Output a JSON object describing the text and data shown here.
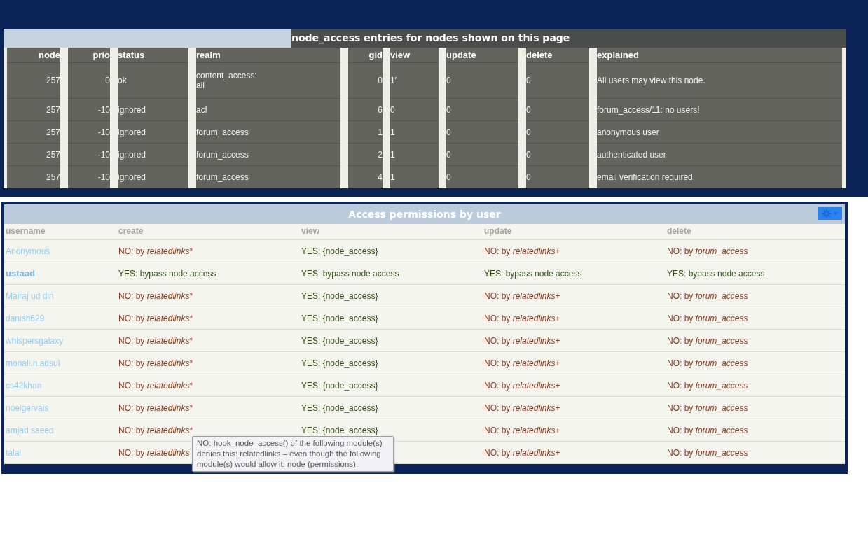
{
  "node_access_table": {
    "title": "node_access entries for nodes shown on this page",
    "columns": [
      "node",
      "prio",
      "status",
      "realm",
      "gid",
      "view",
      "update",
      "delete",
      "explained"
    ],
    "rows": [
      {
        "cells": [
          "257",
          "0",
          "ok",
          "content_access:\nall",
          "0",
          "1′",
          "0",
          "0",
          "All users may view this node."
        ]
      },
      {
        "cells": [
          "257",
          "-10",
          "ignored",
          "acl",
          "6",
          "0",
          "0",
          "0",
          "forum_access/11: no users!"
        ]
      },
      {
        "cells": [
          "257",
          "-10",
          "ignored",
          "forum_access",
          "1",
          "1",
          "0",
          "0",
          "anonymous user"
        ]
      },
      {
        "cells": [
          "257",
          "-10",
          "ignored",
          "forum_access",
          "2",
          "1",
          "0",
          "0",
          "authenticated user"
        ]
      },
      {
        "cells": [
          "257",
          "-10",
          "ignored",
          "forum_access",
          "4",
          "1",
          "0",
          "0",
          "email verification required"
        ]
      }
    ]
  },
  "permissions_table": {
    "title": "Access permissions by user",
    "columns": [
      "username",
      "create",
      "view",
      "update",
      "delete"
    ],
    "rows": [
      {
        "cells": [
          {
            "kind": "user",
            "text": "Anonymous",
            "current": false
          },
          {
            "kind": "deny",
            "prefix": "NO: by",
            "module": "relatedlinks",
            "suffix": "*"
          },
          {
            "kind": "allow",
            "text": "YES: {node_access}"
          },
          {
            "kind": "deny",
            "prefix": "NO: by",
            "module": "relatedlinks",
            "suffix": "+"
          },
          {
            "kind": "deny",
            "prefix": "NO: by",
            "module": "forum_access"
          }
        ]
      },
      {
        "cells": [
          {
            "kind": "user",
            "text": "ustaad",
            "current": true
          },
          {
            "kind": "allow",
            "text": "YES: bypass node access"
          },
          {
            "kind": "allow",
            "text": "YES: bypass node access"
          },
          {
            "kind": "allow",
            "text": "YES: bypass node access"
          },
          {
            "kind": "allow",
            "text": "YES: bypass node access"
          }
        ]
      },
      {
        "cells": [
          {
            "kind": "user",
            "text": "Mairaj ud din",
            "current": false
          },
          {
            "kind": "deny",
            "prefix": "NO: by",
            "module": "relatedlinks",
            "suffix": "*"
          },
          {
            "kind": "allow",
            "text": "YES: {node_access}"
          },
          {
            "kind": "deny",
            "prefix": "NO: by",
            "module": "relatedlinks",
            "suffix": "+"
          },
          {
            "kind": "deny",
            "prefix": "NO: by",
            "module": "forum_access"
          }
        ]
      },
      {
        "cells": [
          {
            "kind": "user",
            "text": "danish629",
            "current": false
          },
          {
            "kind": "deny",
            "prefix": "NO: by",
            "module": "relatedlinks",
            "suffix": "*"
          },
          {
            "kind": "allow",
            "text": "YES: {node_access}"
          },
          {
            "kind": "deny",
            "prefix": "NO: by",
            "module": "relatedlinks",
            "suffix": "+"
          },
          {
            "kind": "deny",
            "prefix": "NO: by",
            "module": "forum_access"
          }
        ]
      },
      {
        "cells": [
          {
            "kind": "user",
            "text": "whispersgalaxy",
            "current": false
          },
          {
            "kind": "deny",
            "prefix": "NO: by",
            "module": "relatedlinks",
            "suffix": "*"
          },
          {
            "kind": "allow",
            "text": "YES: {node_access}"
          },
          {
            "kind": "deny",
            "prefix": "NO: by",
            "module": "relatedlinks",
            "suffix": "+"
          },
          {
            "kind": "deny",
            "prefix": "NO: by",
            "module": "forum_access"
          }
        ]
      },
      {
        "cells": [
          {
            "kind": "user",
            "text": "monali.n.adsul",
            "current": false
          },
          {
            "kind": "deny",
            "prefix": "NO: by",
            "module": "relatedlinks",
            "suffix": "*"
          },
          {
            "kind": "allow",
            "text": "YES: {node_access}"
          },
          {
            "kind": "deny",
            "prefix": "NO: by",
            "module": "relatedlinks",
            "suffix": "+"
          },
          {
            "kind": "deny",
            "prefix": "NO: by",
            "module": "forum_access"
          }
        ]
      },
      {
        "cells": [
          {
            "kind": "user",
            "text": "cs42khan",
            "current": false
          },
          {
            "kind": "deny",
            "prefix": "NO: by",
            "module": "relatedlinks",
            "suffix": "*"
          },
          {
            "kind": "allow",
            "text": "YES: {node_access}"
          },
          {
            "kind": "deny",
            "prefix": "NO: by",
            "module": "relatedlinks",
            "suffix": "+"
          },
          {
            "kind": "deny",
            "prefix": "NO: by",
            "module": "forum_access"
          }
        ]
      },
      {
        "cells": [
          {
            "kind": "user",
            "text": "noelgervais",
            "current": false
          },
          {
            "kind": "deny",
            "prefix": "NO: by",
            "module": "relatedlinks",
            "suffix": "*"
          },
          {
            "kind": "allow",
            "text": "YES: {node_access}"
          },
          {
            "kind": "deny",
            "prefix": "NO: by",
            "module": "relatedlinks",
            "suffix": "+"
          },
          {
            "kind": "deny",
            "prefix": "NO: by",
            "module": "forum_access"
          }
        ]
      },
      {
        "cells": [
          {
            "kind": "user",
            "text": "amjad saeed",
            "current": false
          },
          {
            "kind": "deny",
            "prefix": "NO: by",
            "module": "relatedlinks",
            "suffix": "*"
          },
          {
            "kind": "allow",
            "text": "YES: {node_access}"
          },
          {
            "kind": "deny",
            "prefix": "NO: by",
            "module": "relatedlinks",
            "suffix": "+"
          },
          {
            "kind": "deny",
            "prefix": "NO: by",
            "module": "forum_access"
          }
        ]
      },
      {
        "cells": [
          {
            "kind": "user",
            "text": "talal",
            "current": false
          },
          {
            "kind": "deny",
            "prefix": "NO: by",
            "module": "relatedlinks"
          },
          {
            "kind": "hidden"
          },
          {
            "kind": "deny",
            "prefix": "NO: by",
            "module": "relatedlinks",
            "suffix": "+"
          },
          {
            "kind": "deny",
            "prefix": "NO: by",
            "module": "forum_access"
          }
        ]
      }
    ]
  },
  "tooltip": {
    "text": "NO: hook_node_access() of the following module(s) denies this: relatedlinks – even though the following module(s) would allow it: node (permissions)."
  }
}
